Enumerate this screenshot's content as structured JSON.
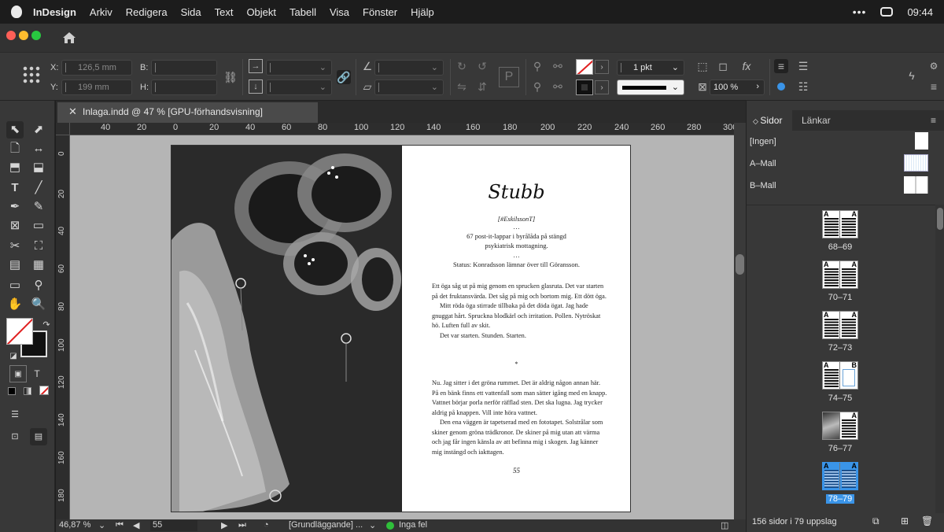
{
  "menubar": {
    "app": "InDesign",
    "items": [
      "Arkiv",
      "Redigera",
      "Sida",
      "Text",
      "Objekt",
      "Tabell",
      "Visa",
      "Fönster",
      "Hjälp"
    ],
    "clock": "09:44"
  },
  "control": {
    "x_label": "X:",
    "x_value": "126,5 mm",
    "y_label": "Y:",
    "y_value": "199 mm",
    "b_label": "B:",
    "h_label": "H:",
    "stroke_weight": "1 pkt",
    "scale": "100 %"
  },
  "document": {
    "tab_title": "Inlaga.indd @ 47 % [GPU-förhandsvisning]",
    "ruler_numbers": [
      "40",
      "20",
      "0",
      "20",
      "40",
      "60",
      "80",
      "100",
      "120",
      "140",
      "160",
      "180",
      "200",
      "220",
      "240",
      "260",
      "280",
      "300"
    ],
    "vruler_numbers": [
      "0",
      "20",
      "40",
      "60",
      "80",
      "100",
      "120",
      "140",
      "160",
      "180",
      "200"
    ]
  },
  "page": {
    "title": "Stubb",
    "tag": "[#EskilssonT]",
    "dots": "…",
    "line1": "67 post-it-lappar i byrålåda på stängd",
    "line2": "psykiatrisk mottagning.",
    "dots2": "…",
    "status": "Status: Konradsson lämnar över till Göransson.",
    "para1": "Ett öga såg ut på mig genom en sprucken glasruta. Det var starten på det fruktansvärda. Det såg på mig och bortom mig. Ett dött öga.",
    "para2": "Mitt röda öga stirrade tillbaka på det döda ögat. Jag hade gnuggat hårt. Spruckna blodkärl och irritation. Pollen. Nytröskat hö. Luften full av skit.",
    "para3": "Det var starten. Stunden. Starten.",
    "separator": "*",
    "para4": "Nu. Jag sitter i det gröna rummet. Det är aldrig någon annan här. På en bänk finns ett vattenfall som man sätter igång med en knapp. Vattnet börjar porla nerför räfflad sten. Det ska lugna. Jag trycker aldrig på knappen. Vill inte höra vattnet.",
    "para5": "Den ena väggen är tapetserad med en fototapet. Solstrålar som skiner genom gröna trädkronor. De skiner på mig utan att värma och jag får ingen känsla av att befinna mig i skogen. Jag känner mig instängd och iakttagen.",
    "page_number": "55"
  },
  "statusbar": {
    "zoom": "46,87 %",
    "page": "55",
    "profile": "[Grundläggande] ...",
    "preflight": "Inga fel"
  },
  "panel": {
    "tab_pages": "Sidor",
    "tab_links": "Länkar",
    "masters": [
      "[Ingen]",
      "A–Mall",
      "B–Mall"
    ],
    "spreads": [
      "68–69",
      "70–71",
      "72–73",
      "74–75",
      "76–77",
      "78–79"
    ],
    "footer": "156 sidor i 79 uppslag"
  },
  "colors": {
    "accent": "#3a94e8",
    "preflight_ok": "#2fbf3a",
    "fill_none_red": "#e02020"
  }
}
